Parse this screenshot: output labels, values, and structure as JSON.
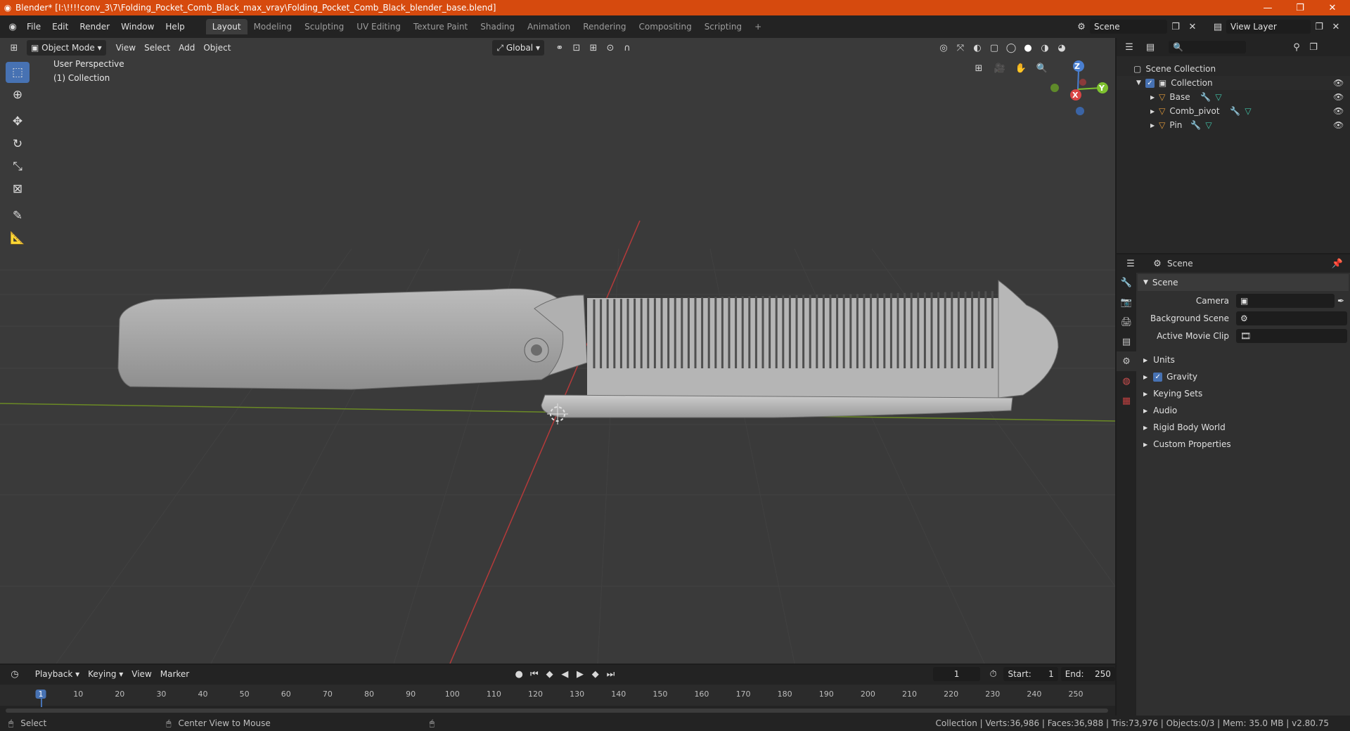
{
  "titlebar": {
    "title": "Blender* [I:\\!!!!conv_3\\7\\Folding_Pocket_Comb_Black_max_vray\\Folding_Pocket_Comb_Black_blender_base.blend]",
    "minimize": "—",
    "restore": "❐",
    "close": "✕"
  },
  "menu": [
    "File",
    "Edit",
    "Render",
    "Window",
    "Help"
  ],
  "workspaces": [
    "Layout",
    "Modeling",
    "Sculpting",
    "UV Editing",
    "Texture Paint",
    "Shading",
    "Animation",
    "Rendering",
    "Compositing",
    "Scripting"
  ],
  "scene_field": "Scene",
  "view_layer_field": "View Layer",
  "viewport": {
    "mode": "Object Mode",
    "menus": [
      "View",
      "Select",
      "Add",
      "Object"
    ],
    "orientation": "Global",
    "view_name": "User Perspective",
    "collection_label": "(1) Collection",
    "gizmo": {
      "z": "Z",
      "y": "Y",
      "x": "X"
    }
  },
  "outliner": {
    "scene_collection": "Scene Collection",
    "collection": "Collection",
    "objects": [
      "Base",
      "Comb_pivot",
      "Pin"
    ]
  },
  "properties": {
    "context": "Scene",
    "panel": "Scene",
    "fields": {
      "camera": "Camera",
      "background_scene": "Background Scene",
      "active_movie_clip": "Active Movie Clip"
    },
    "sections": [
      "Units",
      "Gravity",
      "Keying Sets",
      "Audio",
      "Rigid Body World",
      "Custom Properties"
    ]
  },
  "timeline": {
    "menus": [
      "Playback",
      "Keying",
      "View",
      "Marker"
    ],
    "current_frame": "1",
    "start_label": "Start:",
    "start": "1",
    "end_label": "End:",
    "end": "250",
    "ticks": [
      "1",
      "10",
      "20",
      "30",
      "40",
      "50",
      "60",
      "70",
      "80",
      "90",
      "100",
      "110",
      "120",
      "130",
      "140",
      "150",
      "160",
      "170",
      "180",
      "190",
      "200",
      "210",
      "220",
      "230",
      "240",
      "250"
    ]
  },
  "status": {
    "select": "Select",
    "center": "Center View to Mouse",
    "stats": "Collection | Verts:36,986 | Faces:36,988 | Tris:73,976 | Objects:0/3 | Mem: 35.0 MB | v2.80.75"
  },
  "colors": {
    "accent": "#4772b3",
    "title_bar": "#d64a0e",
    "object_icon": "#e09a3a",
    "mesh_icon": "#42c4a8"
  }
}
